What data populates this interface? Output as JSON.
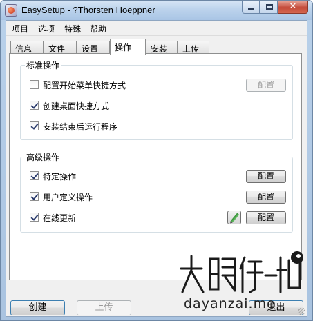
{
  "window": {
    "title": "EasySetup  - ?Thorsten Hoeppner",
    "minimize_icon": "minimize-icon",
    "maximize_icon": "maximize-icon",
    "close_icon": "close-icon",
    "close_glyph": "✕"
  },
  "menu": {
    "items": [
      {
        "label": "项目"
      },
      {
        "label": "选项"
      },
      {
        "label": "特殊"
      },
      {
        "label": "帮助"
      }
    ]
  },
  "tabs": [
    {
      "label": "信息"
    },
    {
      "label": "文件"
    },
    {
      "label": "设置"
    },
    {
      "label": "操作",
      "active": true
    },
    {
      "label": "安装"
    },
    {
      "label": "上传"
    }
  ],
  "standard_group": {
    "title": "标准操作",
    "options": [
      {
        "label": "配置开始菜单快捷方式",
        "checked": false,
        "button": "配置",
        "button_enabled": false
      },
      {
        "label": "创建桌面快捷方式",
        "checked": true
      },
      {
        "label": "安装结束后运行程序",
        "checked": true
      }
    ]
  },
  "advanced_group": {
    "title": "高级操作",
    "options": [
      {
        "label": "特定操作",
        "checked": true,
        "button": "配置"
      },
      {
        "label": "用户定义操作",
        "checked": true,
        "button": "配置"
      },
      {
        "label": "在线更新",
        "checked": true,
        "button": "配置",
        "extra_icon": "pencil-icon"
      }
    ]
  },
  "bottom_buttons": {
    "create": "创建",
    "upload": "上传",
    "exit": "退出"
  },
  "watermark": {
    "chars": "大眼仔-旭",
    "site": "dayanzai.me"
  }
}
